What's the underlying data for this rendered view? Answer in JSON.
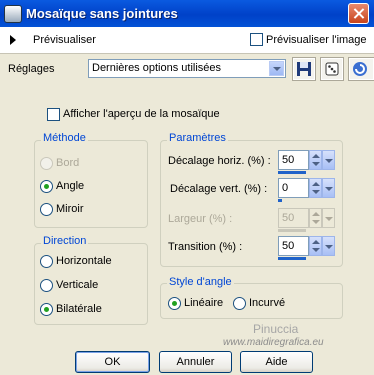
{
  "window": {
    "title": "Mosaïque sans jointures"
  },
  "preview": {
    "label": "Prévisualiser",
    "checkbox_label": "Prévisualiser l'image",
    "checked": false
  },
  "presets": {
    "label": "Réglages",
    "selected": "Dernières options utilisées"
  },
  "show_mosaic": {
    "label": "Afficher l'aperçu de la mosaïque",
    "checked": false
  },
  "method": {
    "legend": "Méthode",
    "options": [
      {
        "label": "Bord",
        "selected": false,
        "disabled": true
      },
      {
        "label": "Angle",
        "selected": true,
        "disabled": false
      },
      {
        "label": "Miroir",
        "selected": false,
        "disabled": false
      }
    ]
  },
  "direction": {
    "legend": "Direction",
    "options": [
      {
        "label": "Horizontale",
        "selected": false
      },
      {
        "label": "Verticale",
        "selected": false
      },
      {
        "label": "Bilatérale",
        "selected": true
      }
    ]
  },
  "params": {
    "legend": "Paramètres",
    "fields": [
      {
        "label": "Décalage horiz. (%) :",
        "value": "50",
        "disabled": false,
        "level": 50
      },
      {
        "label": "Décalage vert. (%) :",
        "value": "0",
        "disabled": false,
        "level": 0
      },
      {
        "label": "Largeur (%) :",
        "value": "50",
        "disabled": true,
        "level": 50
      },
      {
        "label": "Transition (%) :",
        "value": "50",
        "disabled": false,
        "level": 50
      }
    ]
  },
  "corner_style": {
    "legend": "Style d'angle",
    "options": [
      {
        "label": "Linéaire",
        "selected": true
      },
      {
        "label": "Incurvé",
        "selected": false
      }
    ]
  },
  "buttons": {
    "ok": "OK",
    "cancel": "Annuler",
    "help": "Aide"
  },
  "watermark": {
    "name": "Pinuccia",
    "url": "www.maidiregrafica.eu"
  }
}
